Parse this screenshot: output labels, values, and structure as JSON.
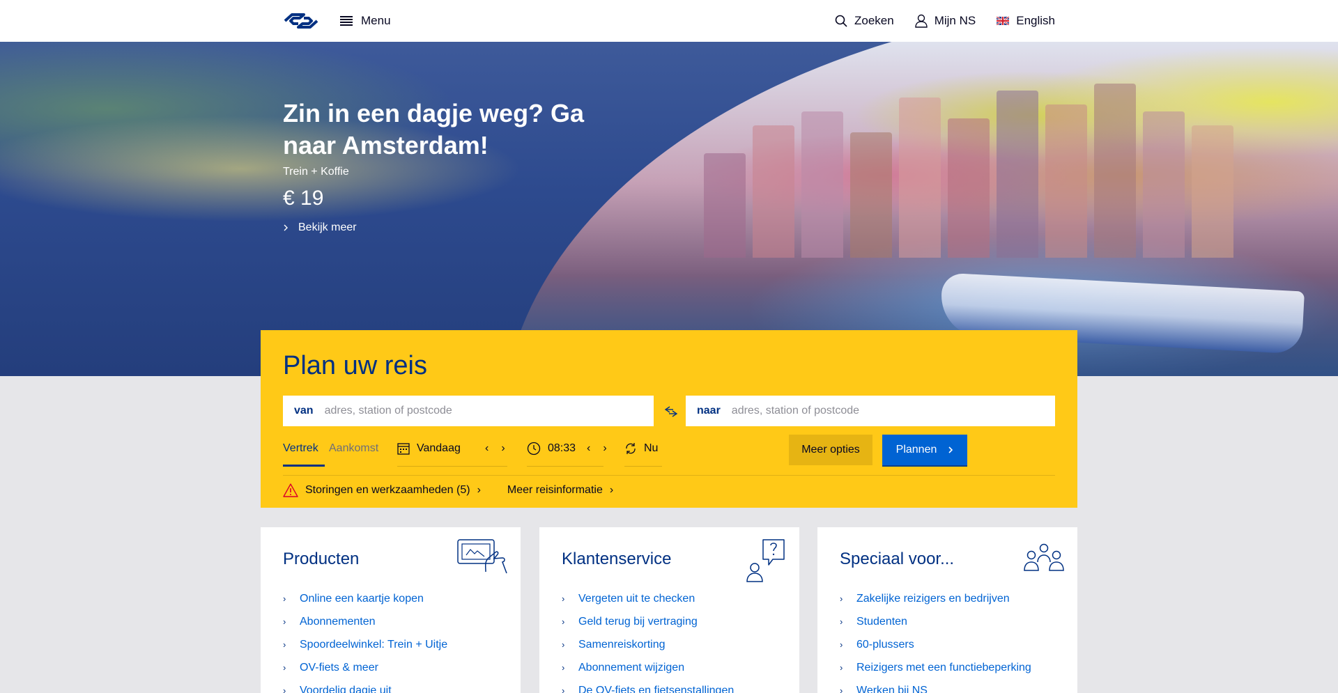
{
  "header": {
    "menu_label": "Menu",
    "search_label": "Zoeken",
    "account_label": "Mijn NS",
    "language_label": "English"
  },
  "hero": {
    "title": "Zin in een dagje weg? Ga naar Amsterdam!",
    "subtitle": "Trein + Koffie",
    "price": "€ 19",
    "link_label": "Bekijk meer"
  },
  "planner": {
    "title": "Plan uw reis",
    "from_label": "van",
    "from_placeholder": "adres, station of postcode",
    "to_label": "naar",
    "to_placeholder": "adres, station of postcode",
    "tab_departure": "Vertrek",
    "tab_arrival": "Aankomst",
    "date_value": "Vandaag",
    "time_value": "08:33",
    "now_label": "Nu",
    "more_options_label": "Meer opties",
    "plan_label": "Plannen",
    "disruptions_label": "Storingen en werkzaamheden (5)",
    "more_info_label": "Meer reisinformatie"
  },
  "cards": [
    {
      "title": "Producten",
      "items": [
        "Online een kaartje kopen",
        "Abonnementen",
        "Spoordeelwinkel: Trein + Uitje",
        "OV-fiets & meer",
        "Voordelig dagje uit"
      ]
    },
    {
      "title": "Klantenservice",
      "items": [
        "Vergeten uit te checken",
        "Geld terug bij vertraging",
        "Samenreiskorting",
        "Abonnement wijzigen",
        "De OV-fiets en fietsenstallingen"
      ]
    },
    {
      "title": "Speciaal voor...",
      "items": [
        "Zakelijke reizigers en bedrijven",
        "Studenten",
        "60-plussers",
        "Reizigers met een functiebeperking",
        "Werken bij NS"
      ]
    }
  ],
  "colors": {
    "brand_yellow": "#ffc917",
    "brand_blue": "#003082",
    "link_blue": "#0063d3",
    "background": "#e6e6e9"
  },
  "icons": [
    "ns-logo",
    "menu-icon",
    "search-icon",
    "user-icon",
    "uk-flag-icon",
    "chevron-right-icon",
    "swap-icon",
    "calendar-icon",
    "clock-icon",
    "refresh-icon",
    "warning-icon",
    "ticket-card-icon",
    "help-question-icon",
    "group-people-icon"
  ]
}
